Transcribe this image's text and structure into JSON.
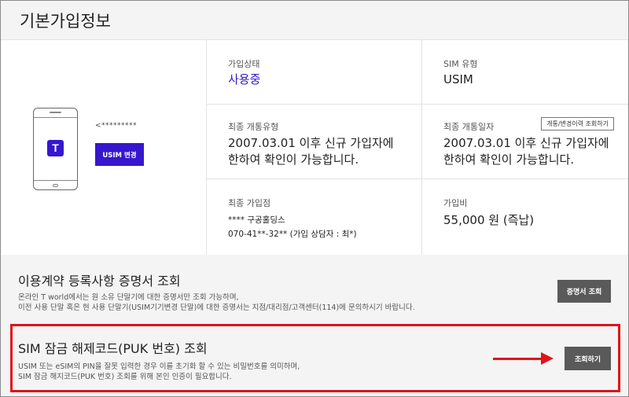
{
  "header": {
    "title": "기본가입정보"
  },
  "device": {
    "logo_letter": "T",
    "masked_number": "<*********",
    "usim_change_label": "USIM 변경"
  },
  "info": {
    "status": {
      "label": "가입상태",
      "value": "사용중"
    },
    "sim_type": {
      "label": "SIM 유형",
      "value": "USIM"
    },
    "last_open_type": {
      "label": "최종 개통유형",
      "value_line1": "2007.03.01 이후 신규 가입자에",
      "value_line2": "한하여 확인이 가능합니다."
    },
    "last_open_date": {
      "label": "최종 개통일자",
      "value_line1": "2007.03.01 이후 신규 가입자에",
      "value_line2": "한하여 확인이 가능합니다.",
      "history_button": "개통/변경이력 조회하기"
    },
    "last_store": {
      "label": "최종 가입점",
      "store_name": "**** 구공홀딩스",
      "store_phone": "070-41**-32** (가입 상담자 : 최*)"
    },
    "join_fee": {
      "label": "가입비",
      "value": "55,000 원 (즉납)"
    }
  },
  "certificate": {
    "title": "이용계약 등록사항 증명서 조회",
    "desc_line1": "온라인 T world에서는 원 소유 단말기에 대한 증명서만 조회 가능하며,",
    "desc_line2": "이전 사용 단말 혹은 현 사용 단말기(USIM기기변경 단말)에 대한 증명서는 지점/대리점/고객센터(114)에 문의하시기 바랍니다.",
    "button": "증명서 조회"
  },
  "puk": {
    "title": "SIM 잠금 해제코드(PUK 번호) 조회",
    "desc_line1": "USIM 또는 eSIM의 PIN을 잘못 입력한 경우 이를 초기화 할 수 있는 비밀번호를 의미하며,",
    "desc_line2": "SIM 잠금 해지코드(PUK 번호) 조회를 위해 본인 인증이 필요합니다.",
    "button": "조회하기"
  },
  "colors": {
    "accent": "#3617ce",
    "highlight": "#e0141a",
    "dark_button": "#5a5a5a"
  }
}
